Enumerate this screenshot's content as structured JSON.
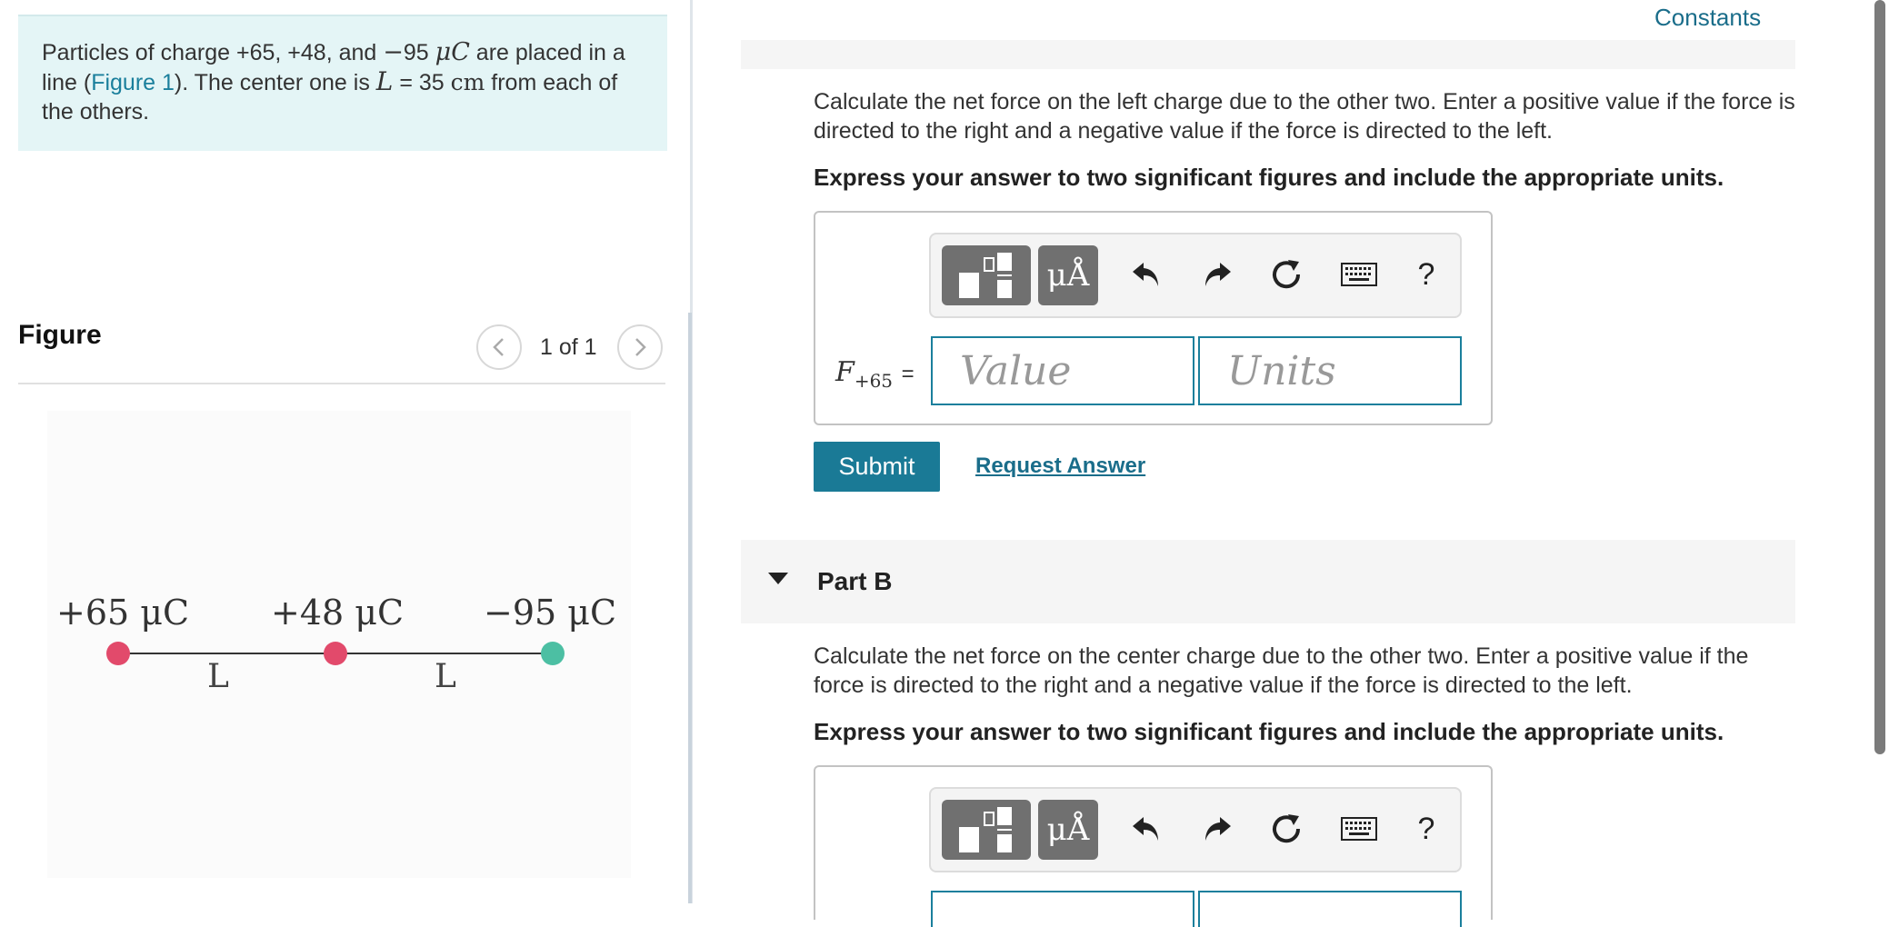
{
  "problem": {
    "t1": "Particles of charge +65, +48, and ",
    "minus": "−",
    "q3": "95 ",
    "mu_unit": "μC",
    "t2": " are placed in a line (",
    "figure_link": "Figure 1",
    "t3": "). The center one is ",
    "L": "L",
    "t4": " = 35 ",
    "cm": "cm",
    "t5": " from each of the others."
  },
  "figure": {
    "heading": "Figure",
    "counter": "1 of 1",
    "prev_icon": "chevron-left-icon",
    "next_icon": "chevron-right-icon",
    "charges": [
      {
        "label": "+65 μC",
        "color": "#e24a6b"
      },
      {
        "label": "+48 μC",
        "color": "#e24a6b"
      },
      {
        "label": "−95 μC",
        "color": "#4cbfa3"
      }
    ],
    "spacing_labels": [
      "L",
      "L"
    ]
  },
  "header": {
    "constants": "Constants"
  },
  "part_a": {
    "question": "Calculate the net force on the left charge due to the other two. Enter a positive value if the force is directed to the right and a negative value if the force is directed to the left.",
    "instruction": "Express your answer to two significant figures and include the appropriate units.",
    "var_symbol": "F",
    "var_sub": "+65",
    "equals": "=",
    "value_placeholder": "Value",
    "units_placeholder": "Units",
    "submit": "Submit",
    "request_answer": "Request Answer"
  },
  "part_b": {
    "title": "Part B",
    "question": "Calculate the net force on the center charge due to the other two. Enter a positive value if the force is directed to the right and a negative value if the force is directed to the left.",
    "instruction": "Express your answer to two significant figures and include the appropriate units."
  },
  "toolbar": {
    "units_label": "μÅ",
    "help_label": "?",
    "icons": [
      "templates-icon",
      "units-icon",
      "undo-icon",
      "redo-icon",
      "reset-icon",
      "keyboard-icon",
      "help-icon"
    ]
  },
  "colors": {
    "accent": "#1a7a96",
    "link": "#1a6d8a",
    "problem_bg": "#e4f5f6",
    "positive_charge": "#e24a6b",
    "negative_charge": "#4cbfa3"
  }
}
